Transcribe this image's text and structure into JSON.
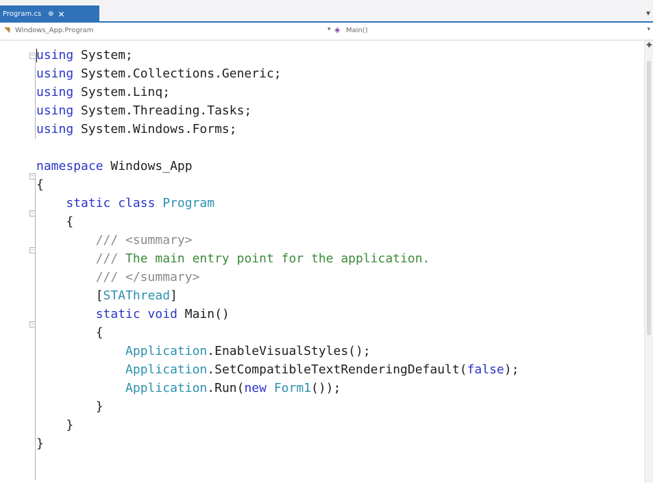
{
  "tab": {
    "label": "Program.cs",
    "pin": "⊕",
    "close": "✕"
  },
  "navbar": {
    "left_label": "Windows_App.Program",
    "right_label": "Main()"
  },
  "code": {
    "lines": [
      [
        [
          "kw",
          "using"
        ],
        [
          "pl",
          " System;"
        ]
      ],
      [
        [
          "kw",
          "using"
        ],
        [
          "pl",
          " System.Collections.Generic;"
        ]
      ],
      [
        [
          "kw",
          "using"
        ],
        [
          "pl",
          " System.Linq;"
        ]
      ],
      [
        [
          "kw",
          "using"
        ],
        [
          "pl",
          " System.Threading.Tasks;"
        ]
      ],
      [
        [
          "kw",
          "using"
        ],
        [
          "pl",
          " System.Windows.Forms;"
        ]
      ],
      [],
      [
        [
          "kw",
          "namespace"
        ],
        [
          "pl",
          " Windows_App"
        ]
      ],
      [
        [
          "pl",
          "{"
        ]
      ],
      [
        [
          "pl",
          "    "
        ],
        [
          "kw",
          "static class"
        ],
        [
          "pl",
          " "
        ],
        [
          "ty",
          "Program"
        ]
      ],
      [
        [
          "pl",
          "    {"
        ]
      ],
      [
        [
          "pl",
          "        "
        ],
        [
          "cmg",
          "/// <summary>"
        ]
      ],
      [
        [
          "pl",
          "        "
        ],
        [
          "cmg",
          "///"
        ],
        [
          "cm",
          " The main entry point for the application."
        ]
      ],
      [
        [
          "pl",
          "        "
        ],
        [
          "cmg",
          "/// </summary>"
        ]
      ],
      [
        [
          "pl",
          "        ["
        ],
        [
          "ty",
          "STAThread"
        ],
        [
          "pl",
          "]"
        ]
      ],
      [
        [
          "pl",
          "        "
        ],
        [
          "kw",
          "static void"
        ],
        [
          "pl",
          " Main()"
        ]
      ],
      [
        [
          "pl",
          "        {"
        ]
      ],
      [
        [
          "pl",
          "            "
        ],
        [
          "ty",
          "Application"
        ],
        [
          "pl",
          ".EnableVisualStyles();"
        ]
      ],
      [
        [
          "pl",
          "            "
        ],
        [
          "ty",
          "Application"
        ],
        [
          "pl",
          ".SetCompatibleTextRenderingDefault("
        ],
        [
          "kw",
          "false"
        ],
        [
          "pl",
          ");"
        ]
      ],
      [
        [
          "pl",
          "            "
        ],
        [
          "ty",
          "Application"
        ],
        [
          "pl",
          ".Run("
        ],
        [
          "kw",
          "new"
        ],
        [
          "pl",
          " "
        ],
        [
          "ty",
          "Form1"
        ],
        [
          "pl",
          "());"
        ]
      ],
      [
        [
          "pl",
          "        }"
        ]
      ],
      [
        [
          "pl",
          "    }"
        ]
      ],
      [
        [
          "pl",
          "}"
        ]
      ]
    ]
  },
  "colors": {
    "keyword": "#2a34c8",
    "type": "#2b91af",
    "comment": "#3a8a37",
    "tab_accent": "#2f72b9"
  }
}
